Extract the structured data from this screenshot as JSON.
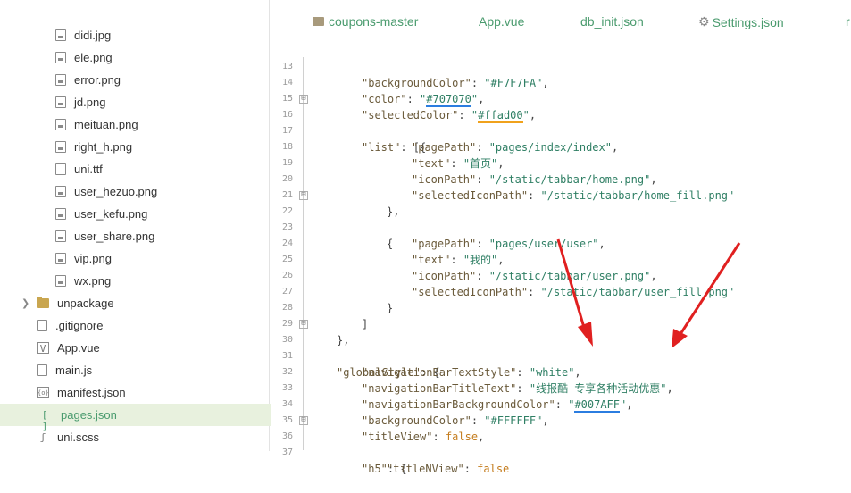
{
  "sidebar": {
    "items": [
      {
        "label": "didi.jpg",
        "icon": "image-file-icon"
      },
      {
        "label": "ele.png",
        "icon": "image-file-icon"
      },
      {
        "label": "error.png",
        "icon": "image-file-icon"
      },
      {
        "label": "jd.png",
        "icon": "image-file-icon"
      },
      {
        "label": "meituan.png",
        "icon": "image-file-icon"
      },
      {
        "label": "right_h.png",
        "icon": "image-file-icon"
      },
      {
        "label": "uni.ttf",
        "icon": "file-icon"
      },
      {
        "label": "user_hezuo.png",
        "icon": "image-file-icon"
      },
      {
        "label": "user_kefu.png",
        "icon": "image-file-icon"
      },
      {
        "label": "user_share.png",
        "icon": "image-file-icon"
      },
      {
        "label": "vip.png",
        "icon": "image-file-icon"
      },
      {
        "label": "wx.png",
        "icon": "image-file-icon"
      },
      {
        "label": "unpackage",
        "icon": "folder-icon"
      },
      {
        "label": ".gitignore",
        "icon": "file-icon"
      },
      {
        "label": "App.vue",
        "icon": "vue-file-icon"
      },
      {
        "label": "main.js",
        "icon": "js-file-icon"
      },
      {
        "label": "manifest.json",
        "icon": "json-file-icon"
      },
      {
        "label": "pages.json",
        "icon": "json-file-icon"
      },
      {
        "label": "uni.scss",
        "icon": "scss-file-icon"
      }
    ],
    "glyphs": {
      "chevron": "❯",
      "vue": "V",
      "json_manifest": "{o}",
      "json_pages": "[ ]",
      "scss": "ʃ"
    }
  },
  "tabs": {
    "folder": "coupons-master",
    "app": "App.vue",
    "db": "db_init.json",
    "settings": "Settings.json",
    "overflow": "r",
    "gear": "⚙"
  },
  "code": {
    "line_numbers": [
      "13",
      "14",
      "15",
      "16",
      "17",
      "18",
      "19",
      "20",
      "21",
      "22",
      "23",
      "24",
      "25",
      "26",
      "27",
      "28",
      "29",
      "30",
      "31",
      "32",
      "33",
      "34",
      "35",
      "36",
      "37"
    ],
    "fold_glyph": "⊟",
    "l13": {
      "key": "\"backgroundColor\"",
      "val": "\"#F7F7FA\""
    },
    "l14": {
      "key": "\"color\"",
      "q1": "\"",
      "val": "#707070",
      "q2": "\""
    },
    "l15": {
      "key": "\"selectedColor\"",
      "q1": "\"",
      "val": "#ffad00",
      "q2": "\""
    },
    "l16": {
      "key": "\"list\"",
      "tail": ": [{"
    },
    "l17": {
      "key": "\"pagePath\"",
      "val": "\"pages/index/index\""
    },
    "l18": {
      "key": "\"text\"",
      "val": "\"首页\""
    },
    "l19": {
      "key": "\"iconPath\"",
      "val": "\"/static/tabbar/home.png\""
    },
    "l20": {
      "key": "\"selectedIconPath\"",
      "val": "\"/static/tabbar/home_fill.png\""
    },
    "l21": {
      "text": "},"
    },
    "l22": {
      "text": "{"
    },
    "l23": {
      "key": "\"pagePath\"",
      "val": "\"pages/user/user\""
    },
    "l24": {
      "key": "\"text\"",
      "val": "\"我的\""
    },
    "l25": {
      "key": "\"iconPath\"",
      "val": "\"/static/tabbar/user.png\""
    },
    "l26": {
      "key": "\"selectedIconPath\"",
      "val": "\"/static/tabbar/user_fill.png\""
    },
    "l27": {
      "text": "}"
    },
    "l28": {
      "text": "]"
    },
    "l29": {
      "text": "},"
    },
    "l30": {
      "key": "\"globalStyle\"",
      "tail": ": {"
    },
    "l31": {
      "key": "\"navigationBarTextStyle\"",
      "val": "\"white\""
    },
    "l32": {
      "key": "\"navigationBarTitleText\"",
      "val": "\"线报酷-专享各种活动优惠\""
    },
    "l33": {
      "key": "\"navigationBarBackgroundColor\"",
      "q1": "\"",
      "val": "#007AFF",
      "q2": "\""
    },
    "l34": {
      "key": "\"backgroundColor\"",
      "val": "\"#FFFFFF\""
    },
    "l35": {
      "key": "\"titleView\"",
      "val": "false"
    },
    "l36": {
      "key": "\"h5\"",
      "tail": ": {"
    },
    "l37": {
      "key": "\"titleNView\"",
      "val": "false"
    },
    "colon": ": ",
    "comma": ","
  },
  "colors": {
    "accent_green": "#4a9b6e",
    "selected_row": "#e8f1de",
    "arrow_red": "#e02020",
    "underline_blue": "#2b7de0",
    "underline_orange": "#f0a21c"
  }
}
